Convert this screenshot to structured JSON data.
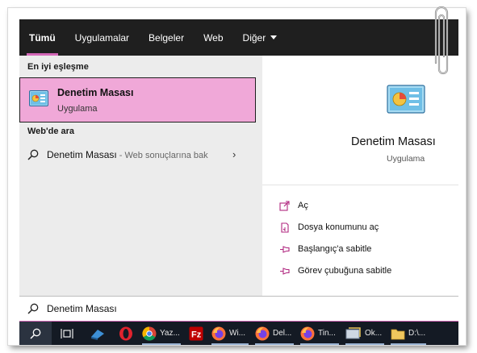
{
  "tabs": [
    {
      "label": "Tümü",
      "active": true
    },
    {
      "label": "Uygulamalar",
      "active": false
    },
    {
      "label": "Belgeler",
      "active": false
    },
    {
      "label": "Web",
      "active": false
    },
    {
      "label": "Diğer",
      "active": false
    }
  ],
  "results": {
    "best_match_title": "En iyi eşleşme",
    "best_match": {
      "name": "Denetim Masası",
      "type": "Uygulama"
    },
    "web_title": "Web'de ara",
    "web_item": {
      "query": "Denetim Masası",
      "hint": " - Web sonuçlarına bak"
    }
  },
  "preview": {
    "name": "Denetim Masası",
    "type": "Uygulama",
    "actions": [
      {
        "label": "Aç",
        "icon": "open-icon"
      },
      {
        "label": "Dosya konumunu aç",
        "icon": "file-location-icon"
      },
      {
        "label": "Başlangıç'a sabitle",
        "icon": "pin-icon"
      },
      {
        "label": "Görev çubuğuna sabitle",
        "icon": "pin-icon"
      }
    ]
  },
  "search": {
    "value": "Denetim Masası"
  },
  "taskbar": {
    "items": [
      {
        "name": "search-icon",
        "label": ""
      },
      {
        "name": "task-view-icon",
        "label": ""
      },
      {
        "name": "app-icon",
        "label": ""
      },
      {
        "name": "opera-icon",
        "label": ""
      },
      {
        "name": "chrome-icon",
        "label": "Yaz..."
      },
      {
        "name": "filezilla-icon",
        "label": ""
      },
      {
        "name": "firefox-icon",
        "label": "Wi..."
      },
      {
        "name": "firefox-icon",
        "label": "Del..."
      },
      {
        "name": "firefox-icon",
        "label": "Tin..."
      },
      {
        "name": "app-icon",
        "label": "Ok..."
      },
      {
        "name": "folder-icon",
        "label": "D:\\..."
      }
    ]
  },
  "colors": {
    "accent": "#d468b8",
    "highlight": "#f0a8d8",
    "tabbar": "#1f1f1f",
    "taskbar": "#141a24"
  }
}
